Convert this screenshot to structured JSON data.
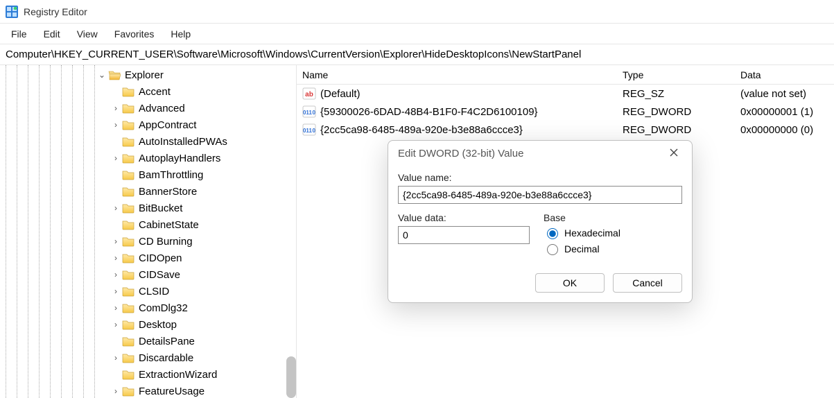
{
  "window": {
    "title": "Registry Editor"
  },
  "menu": [
    "File",
    "Edit",
    "View",
    "Favorites",
    "Help"
  ],
  "address": "Computer\\HKEY_CURRENT_USER\\Software\\Microsoft\\Windows\\CurrentVersion\\Explorer\\HideDesktopIcons\\NewStartPanel",
  "tree": {
    "root": {
      "label": "Explorer",
      "expanded": true
    },
    "children": [
      {
        "label": "Accent",
        "hasChildren": false
      },
      {
        "label": "Advanced",
        "hasChildren": true
      },
      {
        "label": "AppContract",
        "hasChildren": true
      },
      {
        "label": "AutoInstalledPWAs",
        "hasChildren": false
      },
      {
        "label": "AutoplayHandlers",
        "hasChildren": true
      },
      {
        "label": "BamThrottling",
        "hasChildren": false
      },
      {
        "label": "BannerStore",
        "hasChildren": false
      },
      {
        "label": "BitBucket",
        "hasChildren": true
      },
      {
        "label": "CabinetState",
        "hasChildren": false
      },
      {
        "label": "CD Burning",
        "hasChildren": true
      },
      {
        "label": "CIDOpen",
        "hasChildren": true
      },
      {
        "label": "CIDSave",
        "hasChildren": true
      },
      {
        "label": "CLSID",
        "hasChildren": true
      },
      {
        "label": "ComDlg32",
        "hasChildren": true
      },
      {
        "label": "Desktop",
        "hasChildren": true
      },
      {
        "label": "DetailsPane",
        "hasChildren": false
      },
      {
        "label": "Discardable",
        "hasChildren": true
      },
      {
        "label": "ExtractionWizard",
        "hasChildren": false
      },
      {
        "label": "FeatureUsage",
        "hasChildren": true
      }
    ]
  },
  "columns": {
    "name": "Name",
    "type": "Type",
    "data": "Data"
  },
  "values": [
    {
      "icon": "string",
      "name": "(Default)",
      "type": "REG_SZ",
      "data": "(value not set)"
    },
    {
      "icon": "dword",
      "name": "{59300026-6DAD-48B4-B1F0-F4C2D6100109}",
      "type": "REG_DWORD",
      "data": "0x00000001 (1)"
    },
    {
      "icon": "dword",
      "name": "{2cc5ca98-6485-489a-920e-b3e88a6ccce3}",
      "type": "REG_DWORD",
      "data": "0x00000000 (0)"
    }
  ],
  "dialog": {
    "title": "Edit DWORD (32-bit) Value",
    "value_name_label": "Value name:",
    "value_name": "{2cc5ca98-6485-489a-920e-b3e88a6ccce3}",
    "value_data_label": "Value data:",
    "value_data": "0",
    "base_label": "Base",
    "hex_label": "Hexadecimal",
    "dec_label": "Decimal",
    "base_selected": "hex",
    "ok": "OK",
    "cancel": "Cancel"
  },
  "tree_guide_lines": [
    8,
    24,
    40,
    56,
    72,
    88,
    104,
    120,
    136
  ]
}
